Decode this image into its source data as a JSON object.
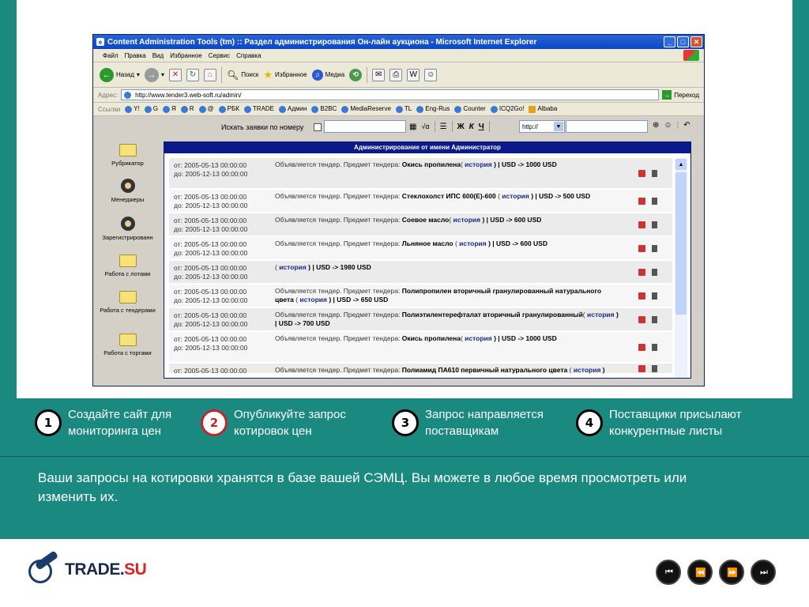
{
  "browser": {
    "title": "Content Administration Tools (tm) :: Раздел администрирования Он-лайн аукциона - Microsoft Internet Explorer",
    "menu": [
      "Файл",
      "Правка",
      "Вид",
      "Избранное",
      "Сервис",
      "Справка"
    ],
    "toolbar": {
      "back": "Назад",
      "search": "Поиск",
      "favorites": "Избранное",
      "media": "Медиа"
    },
    "address_label": "Адрес:",
    "address": "http://www.tender3.web-soft.ru/admin/",
    "go": "Переход",
    "links_label": "Ссылки",
    "links": [
      "Y!",
      "G",
      "Я",
      "R",
      "@",
      "РБК",
      "TRADE",
      "Админ",
      "B2BC",
      "MediaReserve",
      "TL",
      "Eng-Rus",
      "Counter",
      "ICQ2Go!",
      "Albaba"
    ]
  },
  "page": {
    "search_label": "Искать заявки по номеру",
    "tools": {
      "bold": "Ж",
      "italic": "К",
      "underline": "Ч"
    },
    "url_select": "http://",
    "sidebar": [
      "Рубрикатор",
      "Менеджеры",
      "Зарегистрированн",
      "Работа с лотами",
      "Работа с тендерами",
      "Работа с торгами"
    ],
    "panel_title": "Администрирование от имени Администратор",
    "rows": [
      {
        "from": "от: 2005-05-13 00:00:00",
        "to": "до: 2005-12-13 00:00:00",
        "pre": "Объявляется тендер. Предмет тендера: ",
        "item": "Окись пропилена",
        "hist_pre": "( ",
        "hist": "история",
        "tail": " ) | USD -> 1000 USD"
      },
      {
        "from": "от: 2005-05-13 00:00:00",
        "to": "до: 2005-12-13 00:00:00",
        "pre": "Объявляется тендер. Предмет тендера: ",
        "item": "Стеклохолст ИПС 600(Е)-600",
        "hist_pre": " ( ",
        "hist": "история",
        "tail": " ) | USD -> 500 USD"
      },
      {
        "from": "от: 2005-05-13 00:00:00",
        "to": "до: 2005-12-13 00:00:00",
        "pre": "Объявляется тендер. Предмет тендера: ",
        "item": "Соевое масло",
        "hist_pre": "( ",
        "hist": "история",
        "tail": " ) | USD -> 600 USD"
      },
      {
        "from": "от: 2005-05-13 00:00:00",
        "to": "до: 2005-12-13 00:00:00",
        "pre": "Объявляется тендер. Предмет тендера: ",
        "item": "Льняное масло",
        "hist_pre": " ( ",
        "hist": "история",
        "tail": " ) | USD -> 600 USD"
      },
      {
        "from": "от: 2005-05-13 00:00:00",
        "to": "до: 2005-12-13 00:00:00",
        "pre": "",
        "item": "",
        "hist_pre": "( ",
        "hist": "история",
        "tail": " ) | USD -> 1980 USD"
      },
      {
        "from": "от: 2005-05-13 00:00:00",
        "to": "до: 2005-12-13 00:00:00",
        "pre": "Объявляется тендер. Предмет тендера: ",
        "item": "Полипропилен вторичный гранулированный натурального цвета",
        "hist_pre": " ( ",
        "hist": "история",
        "tail": " ) | USD -> 650 USD"
      },
      {
        "from": "от: 2005-05-13 00:00:00",
        "to": "до: 2005-12-13 00:00:00",
        "pre": "Объявляется тендер. Предмет тендера: ",
        "item": "Полиэтилентерефталат вторичный гранулированный",
        "hist_pre": "( ",
        "hist": "история",
        "tail": " ) | USD -> 700 USD"
      },
      {
        "from": "от: 2005-05-13 00:00:00",
        "to": "до: 2005-12-13 00:00:00",
        "pre": "Объявляется тендер. Предмет тендера: ",
        "item": "Окись пропилена",
        "hist_pre": "( ",
        "hist": "история",
        "tail": " ) | USD -> 1000 USD"
      },
      {
        "from": "от: 2005-05-13 00:00:00",
        "to": "",
        "pre": "Объявляется тендер. Предмет тендера: ",
        "item": "Полиамид ПА610 первичный натурального цвета",
        "hist_pre": " ( ",
        "hist": "история",
        "tail": " )"
      }
    ]
  },
  "steps": [
    {
      "num": "1",
      "text": "Создайте сайт для мониторинга цен"
    },
    {
      "num": "2",
      "text": "Опубликуйте запрос котировок цен"
    },
    {
      "num": "3",
      "text": "Запрос направляется поставщикам"
    },
    {
      "num": "4",
      "text": "Поставщики присылают конкурентные листы"
    }
  ],
  "info": "Ваши запросы на котировки хранятся в базе вашей СЭМЦ. Вы можете в любое время просмотреть или изменить их.",
  "logo": {
    "main": "TRADE.",
    "accent": "SU"
  },
  "nav": [
    "⏮",
    "⏪",
    "⏩",
    "⏭"
  ]
}
